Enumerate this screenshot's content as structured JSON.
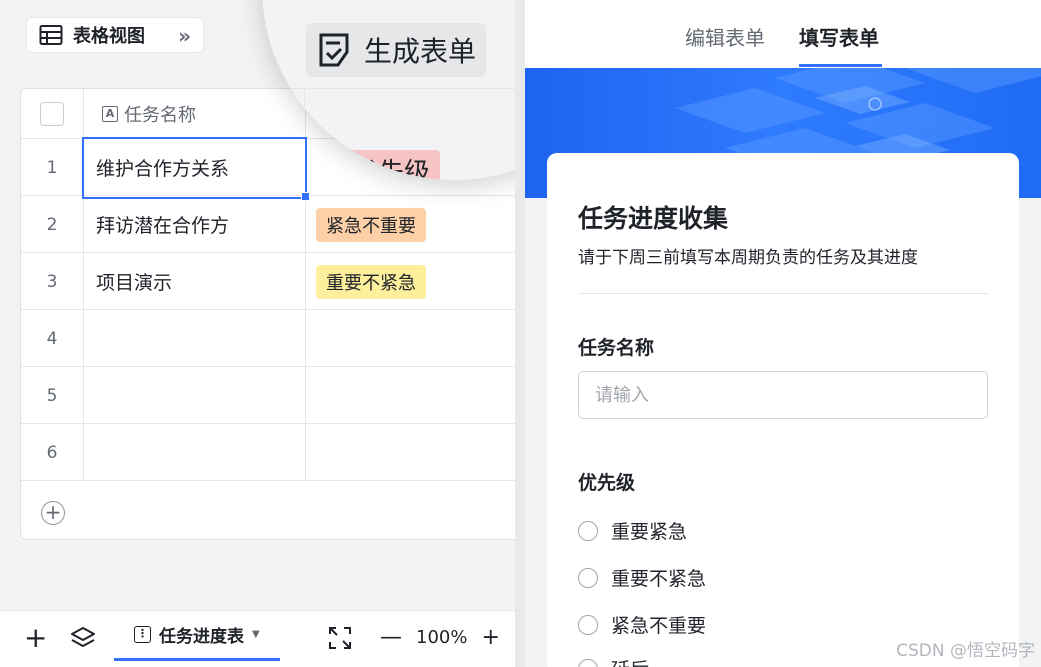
{
  "toolbar": {
    "view_label": "表格视图",
    "expand_glyph": "»"
  },
  "grid": {
    "header": {
      "column1": "任务名称",
      "column_type_glyph": "A"
    },
    "rows": [
      {
        "num": "1",
        "name": "维护合作方关系",
        "priority": ""
      },
      {
        "num": "2",
        "name": "拜访潜在合作方",
        "priority": "紧急不重要"
      },
      {
        "num": "3",
        "name": "项目演示",
        "priority": "重要不紧急"
      },
      {
        "num": "4",
        "name": "",
        "priority": ""
      },
      {
        "num": "5",
        "name": "",
        "priority": ""
      },
      {
        "num": "6",
        "name": "",
        "priority": ""
      }
    ],
    "add_glyph": "+"
  },
  "magnifier": {
    "button_label": "生成表单",
    "tag_partial": "重优先级"
  },
  "bottombar": {
    "add_glyph": "+",
    "sheet_name": "任务进度表",
    "zoom": "100%",
    "zoom_minus": "—",
    "zoom_plus": "+"
  },
  "form_tabs": {
    "edit": "编辑表单",
    "fill": "填写表单"
  },
  "form": {
    "title": "任务进度收集",
    "description": "请于下周三前填写本周期负责的任务及其进度",
    "field1_label": "任务名称",
    "field1_placeholder": "请输入",
    "field2_label": "优先级",
    "options": [
      "重要紧急",
      "重要不紧急",
      "紧急不重要",
      "延后"
    ]
  },
  "colors": {
    "accent": "#3370ff",
    "tag_red": "#f6c4c4",
    "tag_orange": "#fdd0a8",
    "tag_yellow": "#fdef9c",
    "banner": "#2f7bff"
  },
  "watermark": "CSDN @悟空码字"
}
